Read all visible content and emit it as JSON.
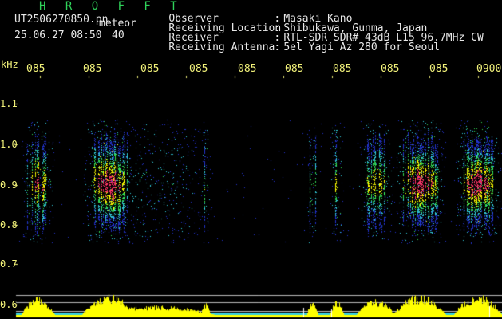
{
  "header": {
    "brand": "H R O F F T",
    "filename": "UT2506270850.pn",
    "filename_suffix": "meteor",
    "timestamp": "25.06.27 08:50",
    "count": "40"
  },
  "meta": [
    {
      "key": "Observer",
      "value": "Masaki Kano"
    },
    {
      "key": "Receiving Location",
      "value": "Shibukawa, Gunma, Japan"
    },
    {
      "key": "Receiver",
      "value": "RTL-SDR SDR# 43dB L15 96.7MHz CW"
    },
    {
      "key": "Receiving Antenna",
      "value": "5el Yagi Az 280 for Seoul"
    }
  ],
  "x_ticks": [
    "085",
    "085",
    "085",
    "085",
    "085",
    "085",
    "085",
    "085",
    "085",
    "0900"
  ],
  "y_axis": {
    "unit": "kHz",
    "ticks": [
      "1.1",
      "1.0",
      "0.9",
      "0.8",
      "0.7",
      "0.6"
    ]
  },
  "colors": {
    "bg": "#000000",
    "label_yellow": "#f2f27a",
    "brand_green": "#2fd35a",
    "blue": "#2233cc",
    "cyan": "#33ccdd",
    "green": "#33dd55",
    "red": "#ff3366",
    "yellow": "#ffff00"
  },
  "bursts": [
    {
      "center": 0.045,
      "width": 0.035,
      "intensity": 0.85
    },
    {
      "center": 0.19,
      "width": 0.055,
      "intensity": 1.0
    },
    {
      "center": 0.29,
      "width": 0.12,
      "intensity": 0.45
    },
    {
      "center": 0.39,
      "width": 0.01,
      "intensity": 0.6
    },
    {
      "center": 0.61,
      "width": 0.012,
      "intensity": 0.7
    },
    {
      "center": 0.66,
      "width": 0.015,
      "intensity": 0.7
    },
    {
      "center": 0.74,
      "width": 0.04,
      "intensity": 0.75
    },
    {
      "center": 0.83,
      "width": 0.055,
      "intensity": 1.0
    },
    {
      "center": 0.95,
      "width": 0.05,
      "intensity": 1.0
    }
  ]
}
